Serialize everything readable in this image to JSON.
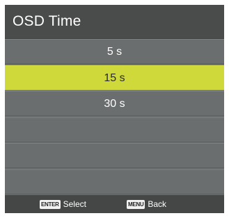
{
  "menu": {
    "title": "OSD Time",
    "options": [
      {
        "label": "5 s",
        "selected": false
      },
      {
        "label": "15 s",
        "selected": true
      },
      {
        "label": "30 s",
        "selected": false
      },
      {
        "label": "",
        "selected": false
      },
      {
        "label": "",
        "selected": false
      },
      {
        "label": "",
        "selected": false
      }
    ]
  },
  "footer": {
    "select_key": "ENTER",
    "select_label": "Select",
    "back_key": "MENU",
    "back_label": "Back"
  },
  "colors": {
    "panel": "#6b6e6e",
    "header": "#4a4c4c",
    "highlight": "#cfd93a",
    "footer": "#454747"
  }
}
